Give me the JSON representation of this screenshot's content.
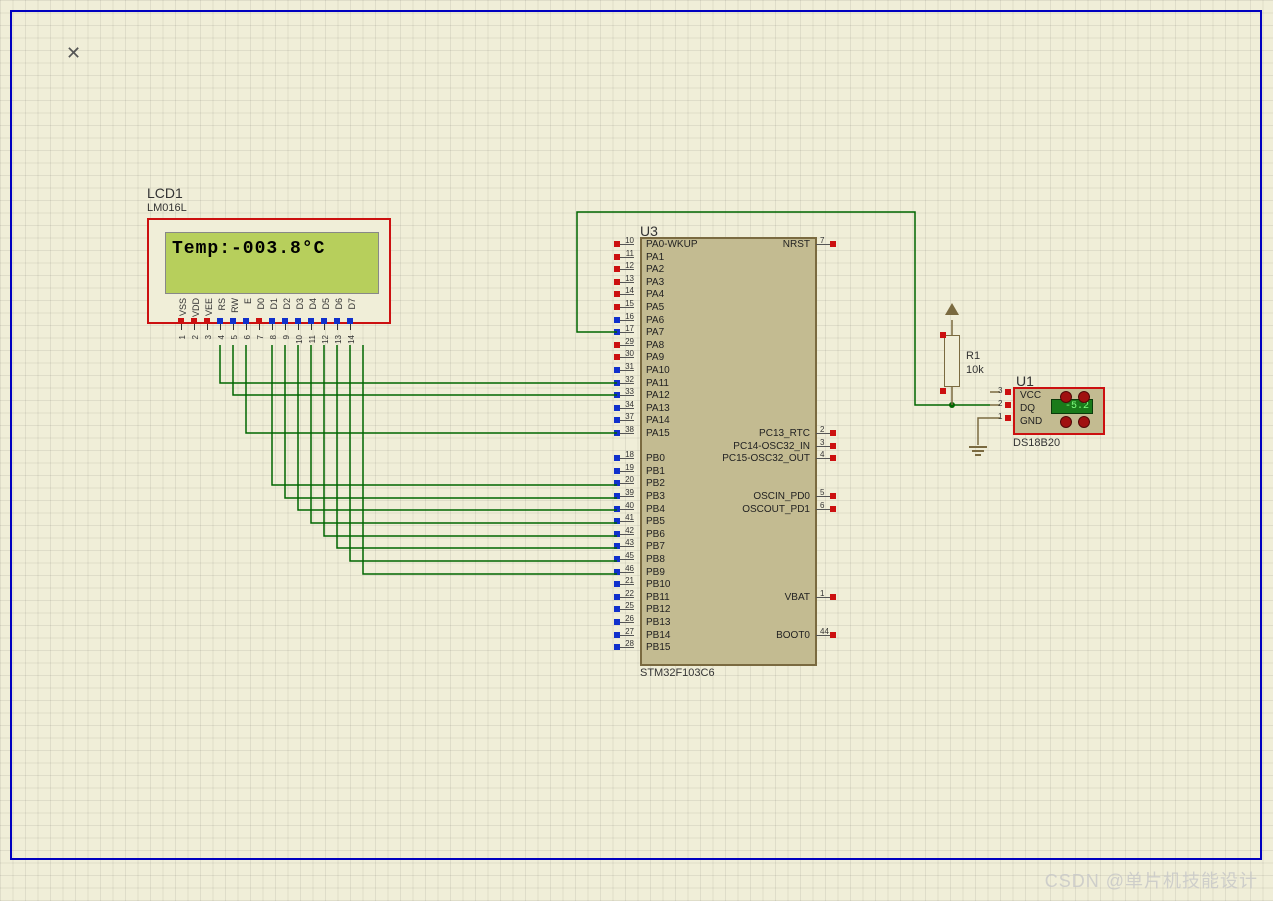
{
  "lcd": {
    "ref": "LCD1",
    "part": "LM016L",
    "display": "Temp:-003.8°C",
    "pins": [
      "VSS",
      "VDD",
      "VEE",
      "RS",
      "RW",
      "E",
      "D0",
      "D1",
      "D2",
      "D3",
      "D4",
      "D5",
      "D6",
      "D7"
    ],
    "pin_nums": [
      "1",
      "2",
      "3",
      "4",
      "5",
      "6",
      "7",
      "8",
      "9",
      "10",
      "11",
      "12",
      "13",
      "14"
    ]
  },
  "mcu": {
    "ref": "U3",
    "part": "STM32F103C6",
    "left_pins": [
      {
        "n": "10",
        "l": "PA0-WKUP"
      },
      {
        "n": "11",
        "l": "PA1"
      },
      {
        "n": "12",
        "l": "PA2"
      },
      {
        "n": "13",
        "l": "PA3"
      },
      {
        "n": "14",
        "l": "PA4"
      },
      {
        "n": "15",
        "l": "PA5"
      },
      {
        "n": "16",
        "l": "PA6"
      },
      {
        "n": "17",
        "l": "PA7"
      },
      {
        "n": "29",
        "l": "PA8"
      },
      {
        "n": "30",
        "l": "PA9"
      },
      {
        "n": "31",
        "l": "PA10"
      },
      {
        "n": "32",
        "l": "PA11"
      },
      {
        "n": "33",
        "l": "PA12"
      },
      {
        "n": "34",
        "l": "PA13"
      },
      {
        "n": "37",
        "l": "PA14"
      },
      {
        "n": "38",
        "l": "PA15"
      },
      {
        "n": "18",
        "l": "PB0"
      },
      {
        "n": "19",
        "l": "PB1"
      },
      {
        "n": "20",
        "l": "PB2"
      },
      {
        "n": "39",
        "l": "PB3"
      },
      {
        "n": "40",
        "l": "PB4"
      },
      {
        "n": "41",
        "l": "PB5"
      },
      {
        "n": "42",
        "l": "PB6"
      },
      {
        "n": "43",
        "l": "PB7"
      },
      {
        "n": "45",
        "l": "PB8"
      },
      {
        "n": "46",
        "l": "PB9"
      },
      {
        "n": "21",
        "l": "PB10"
      },
      {
        "n": "22",
        "l": "PB11"
      },
      {
        "n": "25",
        "l": "PB12"
      },
      {
        "n": "26",
        "l": "PB13"
      },
      {
        "n": "27",
        "l": "PB14"
      },
      {
        "n": "28",
        "l": "PB15"
      }
    ],
    "right_pins": [
      {
        "n": "7",
        "l": "NRST",
        "y": 0
      },
      {
        "n": "2",
        "l": "PC13_RTC",
        "y": 15
      },
      {
        "n": "3",
        "l": "PC14-OSC32_IN",
        "y": 16
      },
      {
        "n": "4",
        "l": "PC15-OSC32_OUT",
        "y": 17
      },
      {
        "n": "5",
        "l": "OSCIN_PD0",
        "y": 20
      },
      {
        "n": "6",
        "l": "OSCOUT_PD1",
        "y": 21
      },
      {
        "n": "1",
        "l": "VBAT",
        "y": 28
      },
      {
        "n": "44",
        "l": "BOOT0",
        "y": 31
      }
    ]
  },
  "res": {
    "ref": "R1",
    "val": "10k"
  },
  "sensor": {
    "ref": "U1",
    "part": "DS18B20",
    "pins": [
      "VCC",
      "DQ",
      "GND"
    ],
    "pin_nums": [
      "3",
      "2",
      "1"
    ],
    "reading": "-5.2"
  },
  "watermark": "CSDN @单片机技能设计"
}
